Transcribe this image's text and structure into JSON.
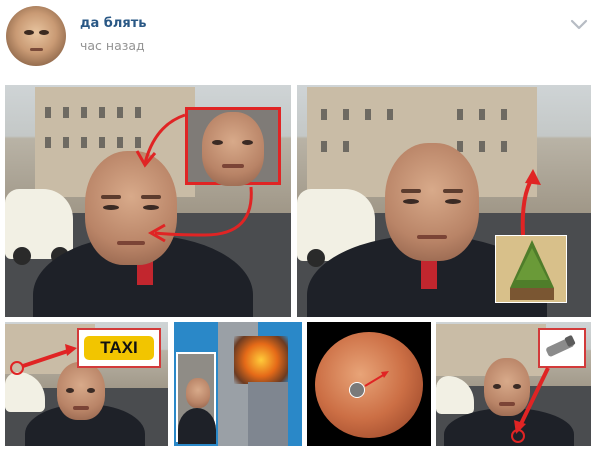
{
  "post": {
    "author_name": "да блять",
    "timestamp": "час назад",
    "icons": {
      "avatar": "avatar-image",
      "menu": "chevron-down-icon"
    }
  },
  "photos": {
    "items": [
      {
        "name": "photo-selfie-with-face-inset"
      },
      {
        "name": "photo-selfie-with-tree-inset"
      },
      {
        "name": "photo-selfie-with-taxi-sign"
      },
      {
        "name": "photo-twin-towers-collage"
      },
      {
        "name": "photo-mars-collage"
      },
      {
        "name": "photo-selfie-with-zipper-inset"
      }
    ],
    "taxi_sign_text": "TAXI"
  },
  "colors": {
    "author_link": "#2a5885",
    "timestamp": "#939393",
    "highlight_red": "#e02424"
  }
}
